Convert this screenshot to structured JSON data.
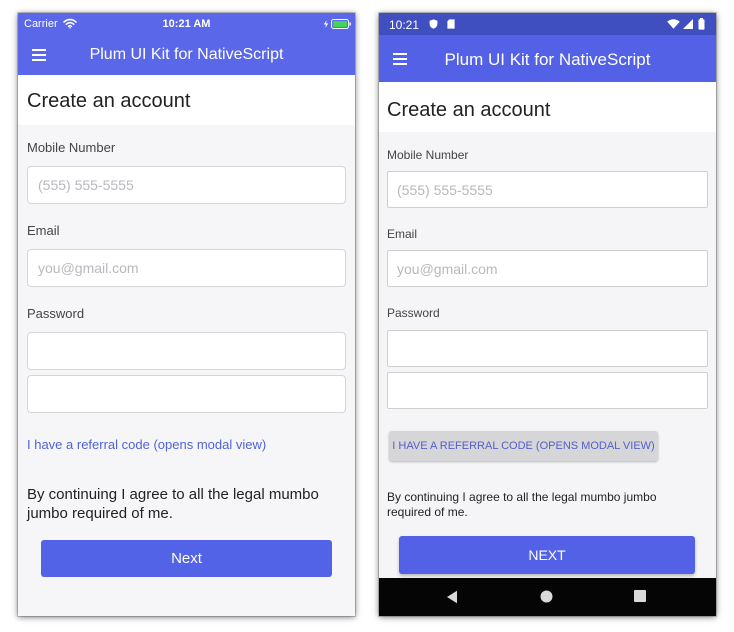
{
  "ios": {
    "status_bar": {
      "carrier": "Carrier",
      "time": "10:21 AM",
      "color": "#5967e8"
    },
    "app_bar": {
      "title": "Plum UI Kit for NativeScript",
      "menu_icon": "menu-icon",
      "color": "#5967e8"
    },
    "page": {
      "title": "Create an account"
    },
    "form": {
      "mobile_label": "Mobile Number",
      "mobile_placeholder": "(555) 555-5555",
      "email_label": "Email",
      "email_placeholder": "you@gmail.com",
      "password_label": "Password",
      "password_value": "",
      "password_confirm_value": ""
    },
    "referral": {
      "label": "I have a referral code (opens modal view)"
    },
    "legal": {
      "text": "By continuing I agree to all the legal mumbo jumbo required of me."
    },
    "next_button": {
      "label": "Next"
    }
  },
  "android": {
    "status_bar": {
      "time": "10:21",
      "color": "#3f4fbf"
    },
    "app_bar": {
      "title": "Plum UI Kit for NativeScript",
      "menu_icon": "menu-icon",
      "color": "#5261e6"
    },
    "page": {
      "title": "Create an account"
    },
    "form": {
      "mobile_label": "Mobile Number",
      "mobile_placeholder": "(555) 555-5555",
      "email_label": "Email",
      "email_placeholder": "you@gmail.com",
      "password_label": "Password",
      "password_value": "",
      "password_confirm_value": ""
    },
    "referral": {
      "label": "I HAVE A REFERRAL CODE (OPENS MODAL VIEW)"
    },
    "legal": {
      "text": "By continuing I agree to all the legal mumbo jumbo required of me."
    },
    "next_button": {
      "label": "NEXT"
    },
    "navigation_bar": {
      "back_icon": "back-icon",
      "home_icon": "home-icon",
      "recent_apps_icon": "recent-apps-icon"
    }
  }
}
